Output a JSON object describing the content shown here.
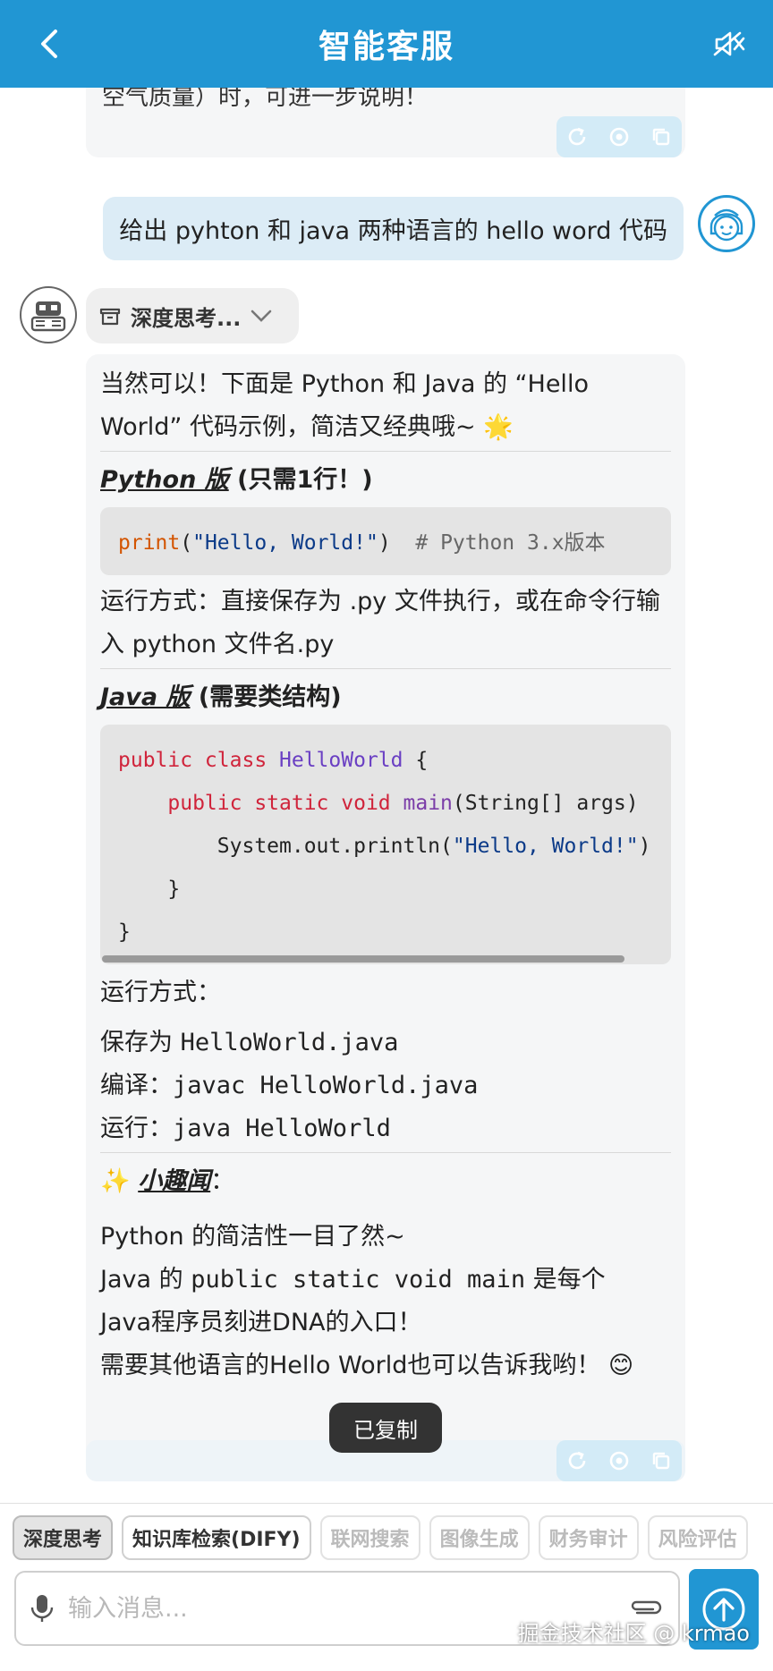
{
  "header": {
    "title": "智能客服"
  },
  "top_fragment": "空气质量）时，可进一步说明！",
  "user_message": "给出 pyhton 和 java 两种语言的 hello word 代码",
  "think_chip": {
    "label": "深度思考..."
  },
  "answer": {
    "intro": "当然可以！下面是 Python 和 Java 的 “Hello World” 代码示例，简洁又经典哦~ 🌟",
    "python_title_em": "Python 版",
    "python_title_rest": "(只需1行！)",
    "python_code": {
      "fn": "print",
      "open": "(",
      "str": "\"Hello, World!\"",
      "close": ")",
      "comment": "  # Python 3.x版本"
    },
    "python_run": "运行方式：直接保存为 .py 文件执行，或在命令行输入 python 文件名.py",
    "java_title_em": "Java 版",
    "java_title_rest": "(需要类结构)",
    "java_code": {
      "l1_kw": "public class ",
      "l1_cls": "HelloWorld",
      "l1_rest": " {",
      "l2_indent": "    ",
      "l2_kw": "public static void ",
      "l2_fn": "main",
      "l2_rest": "(String[] args)",
      "l3_indent": "        ",
      "l3_call": "System.out.println(",
      "l3_str": "\"Hello, World!\"",
      "l3_close": ")",
      "l4": "    }",
      "l5": "}"
    },
    "java_run_label": "运行方式：",
    "java_steps": [
      {
        "label": "保存为 ",
        "code": "HelloWorld.java"
      },
      {
        "label": "编译：",
        "code": "javac HelloWorld.java"
      },
      {
        "label": "运行：",
        "code": "java HelloWorld"
      }
    ],
    "fun_icon": "✨",
    "fun_title": "小趣闻",
    "fun_colon": "：",
    "fun_line1": "Python 的简洁性一目了然~",
    "fun_line2_a": "Java 的 ",
    "fun_line2_code": "public static void main",
    "fun_line2_b": " 是每个",
    "fun_line3": "Java程序员刻进DNA的入口！",
    "fun_line4": "需要其他语言的Hello World也可以告诉我哟！ 😊"
  },
  "toast": "已复制",
  "tools": [
    {
      "label": "深度思考",
      "state": "active"
    },
    {
      "label": "知识库检索(DIFY)",
      "state": "normal"
    },
    {
      "label": "联网搜索",
      "state": "disabled"
    },
    {
      "label": "图像生成",
      "state": "disabled"
    },
    {
      "label": "财务审计",
      "state": "disabled"
    },
    {
      "label": "风险评估",
      "state": "disabled"
    }
  ],
  "input": {
    "placeholder": "输入消息..."
  },
  "watermark": "掘金技术社区 @ krmao",
  "colors": {
    "primary": "#2196d3",
    "bubble_user": "#dcecf6",
    "bubble_bot": "#f5f6f7"
  },
  "icons": [
    "back-chevron-icon",
    "mute-speaker-icon",
    "refresh-icon",
    "target-icon",
    "copy-icon",
    "robot-icon",
    "girl-avatar-icon",
    "box-icon",
    "chevron-down-icon",
    "mic-icon",
    "paperclip-icon",
    "arrow-up-icon"
  ]
}
